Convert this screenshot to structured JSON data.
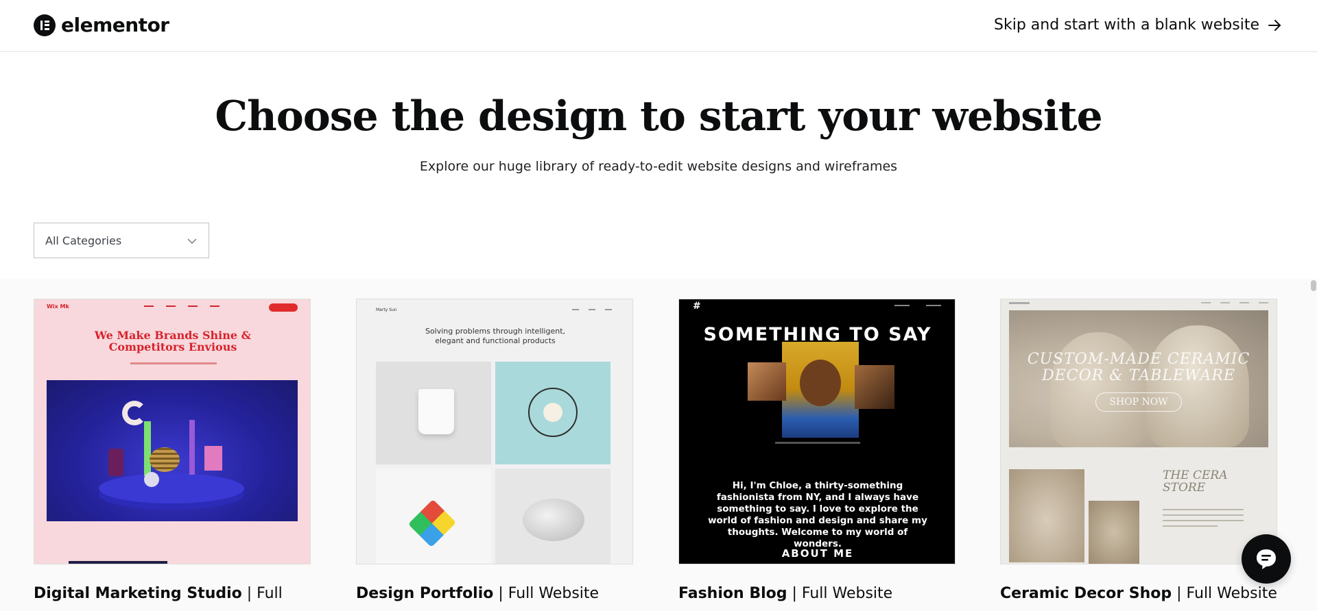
{
  "header": {
    "logo_text": "elementor",
    "skip_label": "Skip and start with a blank website"
  },
  "hero": {
    "title": "Choose the design to start your website",
    "subtitle": "Explore our huge library of ready-to-edit website designs and wireframes"
  },
  "filter": {
    "selected": "All Categories"
  },
  "cards": [
    {
      "name": "Digital Marketing Studio",
      "suffix": " | Full",
      "preview": {
        "logo": "Wix Mk",
        "headline_1": "We Make Brands Shine &",
        "headline_2": "Competitors Envious"
      }
    },
    {
      "name": "Design Portfolio",
      "suffix": " | Full Website",
      "preview": {
        "logo": "Marty Sun",
        "headline_1": "Solving problems through intelligent,",
        "headline_2": "elegant and functional products"
      }
    },
    {
      "name": "Fashion Blog",
      "suffix": " | Full Website",
      "preview": {
        "hash": "#",
        "headline": "SOMETHING TO SAY",
        "blurb": "Hi, I'm Chloe, a thirty-something fashionista from NY, and I always have something to say. I love to explore the world of fashion and design and share my thoughts. Welcome to my world of wonders.",
        "cta": "ABOUT ME"
      }
    },
    {
      "name": "Ceramic Decor Shop",
      "suffix": " | Full Website",
      "preview": {
        "hero_1": "CUSTOM-MADE CERAMIC",
        "hero_2": "DECOR & TABLEWARE",
        "cta": "SHOP NOW",
        "store_1": "THE CERA",
        "store_2": "STORE"
      }
    }
  ],
  "icons": {
    "logo": "elementor-logo-icon",
    "skip": "arrow-right-icon",
    "filter": "chevron-down-icon",
    "chat": "chat-icon"
  },
  "colors": {
    "text": "#0c0d0e",
    "divider": "#e2e2e2",
    "grid_bg": "#fafafa"
  }
}
